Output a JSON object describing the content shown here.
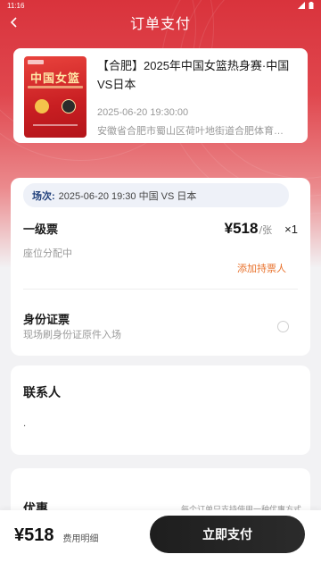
{
  "status_bar": {
    "time": "11:16"
  },
  "header": {
    "title": "订单支付",
    "back_icon": "chevron-left-icon"
  },
  "event": {
    "poster_text": "中国女篮",
    "title": "【合肥】2025年中国女篮热身赛·中国VS日本",
    "time": "2025-06-20 19:30:00",
    "venue": "安徽省合肥市蜀山区荷叶地街道合肥体育…"
  },
  "session": {
    "label": "场次:",
    "value": "2025-06-20 19:30 中国 VS 日本"
  },
  "ticket": {
    "name": "一级票",
    "price": "¥518",
    "unit": "/张",
    "quantity": "×1",
    "seat_note": "座位分配中",
    "add_holder": "添加持票人"
  },
  "id_card": {
    "title": "身份证票",
    "desc": "现场刷身份证原件入场"
  },
  "contact": {
    "title": "联系人",
    "value": "."
  },
  "discount": {
    "title": "优惠",
    "note": "每个订单只支持使用一种优惠方式"
  },
  "footer": {
    "total": "¥518",
    "fee_detail": "费用明细",
    "pay_label": "立即支付"
  },
  "colors": {
    "accent_red": "#d9333c",
    "link_orange": "#e8702a",
    "pay_button": "#1e1e1e"
  }
}
